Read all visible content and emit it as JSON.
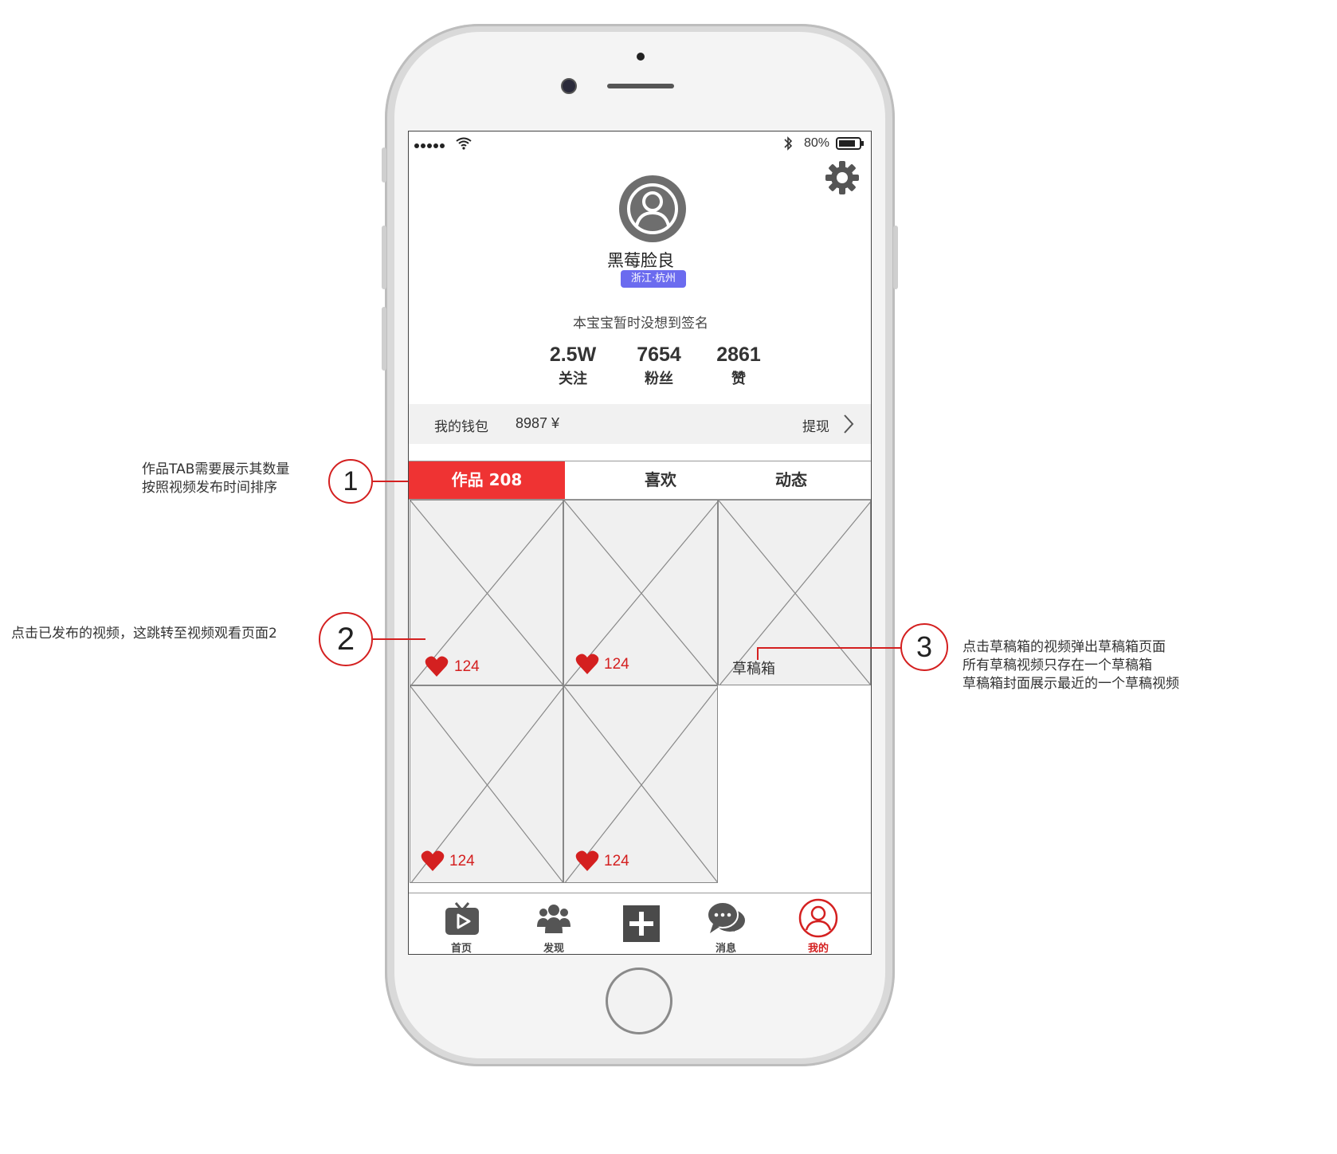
{
  "status_bar": {
    "battery": "80%"
  },
  "profile": {
    "name": "黑莓脸良",
    "location": "浙江·杭州",
    "signature": "本宝宝暂时没想到签名",
    "stats": [
      {
        "value": "2.5W",
        "label": "关注"
      },
      {
        "value": "7654",
        "label": "粉丝"
      },
      {
        "value": "2861",
        "label": "赞"
      }
    ]
  },
  "wallet": {
    "label": "我的钱包",
    "amount": "8987 ¥",
    "withdraw": "提现"
  },
  "tabs": [
    {
      "label": "作品 208",
      "active": true
    },
    {
      "label": "喜欢"
    },
    {
      "label": "动态"
    }
  ],
  "videos": [
    {
      "likes": "124"
    },
    {
      "likes": "124"
    },
    {
      "draft_label": "草稿箱"
    },
    {
      "likes": "124"
    },
    {
      "likes": "124"
    }
  ],
  "nav": [
    {
      "label": "首页",
      "icon": "tv-play-icon"
    },
    {
      "label": "发现",
      "icon": "people-icon"
    },
    {
      "label": "",
      "icon": "plus-icon"
    },
    {
      "label": "消息",
      "icon": "chat-bubble-icon"
    },
    {
      "label": "我的",
      "icon": "user-circle-icon",
      "active": true
    }
  ],
  "annotations": [
    {
      "number": "1",
      "lines": [
        "作品TAB需要展示其数量",
        "按照视频发布时间排序"
      ]
    },
    {
      "number": "2",
      "lines": [
        "点击已发布的视频，这跳转至视频观看页面2"
      ]
    },
    {
      "number": "3",
      "lines": [
        "点击草稿箱的视频弹出草稿箱页面",
        "所有草稿视频只存在一个草稿箱",
        "草稿箱封面展示最近的一个草稿视频"
      ]
    }
  ],
  "colors": {
    "accent": "#ef3333",
    "location_badge": "#6b6bef",
    "annotation": "#d42020"
  }
}
